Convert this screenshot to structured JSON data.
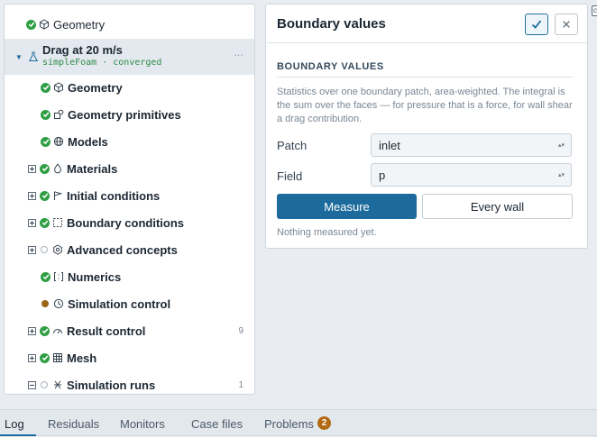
{
  "tree": {
    "top_item": {
      "label": "Geometry",
      "status": "done",
      "icon": "cube-icon"
    },
    "case": {
      "label": "Drag at 20 m/s",
      "subtitle": "simpleFoam · converged",
      "icon": "flask-icon",
      "more": "…"
    },
    "items": [
      {
        "label": "Geometry",
        "status": "done",
        "icon": "cube-icon",
        "expander": "none"
      },
      {
        "label": "Geometry primitives",
        "status": "done",
        "icon": "shapes-icon",
        "expander": "none"
      },
      {
        "label": "Models",
        "status": "done",
        "icon": "globe-icon",
        "expander": "none"
      },
      {
        "label": "Materials",
        "status": "done",
        "icon": "drop-icon",
        "expander": "plus"
      },
      {
        "label": "Initial conditions",
        "status": "done",
        "icon": "flag-icon",
        "expander": "plus"
      },
      {
        "label": "Boundary conditions",
        "status": "done",
        "icon": "boundary-icon",
        "expander": "plus"
      },
      {
        "label": "Advanced concepts",
        "status": "empty",
        "icon": "hexagon-icon",
        "expander": "plus"
      },
      {
        "label": "Numerics",
        "status": "done",
        "icon": "numerics-icon",
        "expander": "none"
      },
      {
        "label": "Simulation control",
        "status": "warning",
        "icon": "clock-icon",
        "expander": "none"
      },
      {
        "label": "Result control",
        "status": "done",
        "icon": "gauge-icon",
        "expander": "plus",
        "count": "9"
      },
      {
        "label": "Mesh",
        "status": "done",
        "icon": "grid-icon",
        "expander": "plus"
      },
      {
        "label": "Simulation runs",
        "status": "empty",
        "icon": "run-icon",
        "expander": "minus",
        "count": "1"
      }
    ]
  },
  "panel": {
    "title": "Boundary values",
    "section": "BOUNDARY VALUES",
    "description": "Statistics over one boundary patch, area-weighted. The integral is the sum over the faces — for pressure that is a force, for wall shear a drag contribution.",
    "patch_label": "Patch",
    "patch_value": "inlet",
    "field_label": "Field",
    "field_value": "p",
    "measure_button": "Measure",
    "every_wall_button": "Every wall",
    "status": "Nothing measured yet."
  },
  "tabs": [
    {
      "label": "Log",
      "active": true
    },
    {
      "label": "Residuals"
    },
    {
      "label": "Monitors"
    },
    {
      "label": "Case files"
    },
    {
      "label": "Problems",
      "badge": "2"
    }
  ],
  "colors": {
    "accent": "#1d6b9c",
    "done": "#2f9e44",
    "warning": "#9a6418",
    "badge": "#b36a14"
  }
}
